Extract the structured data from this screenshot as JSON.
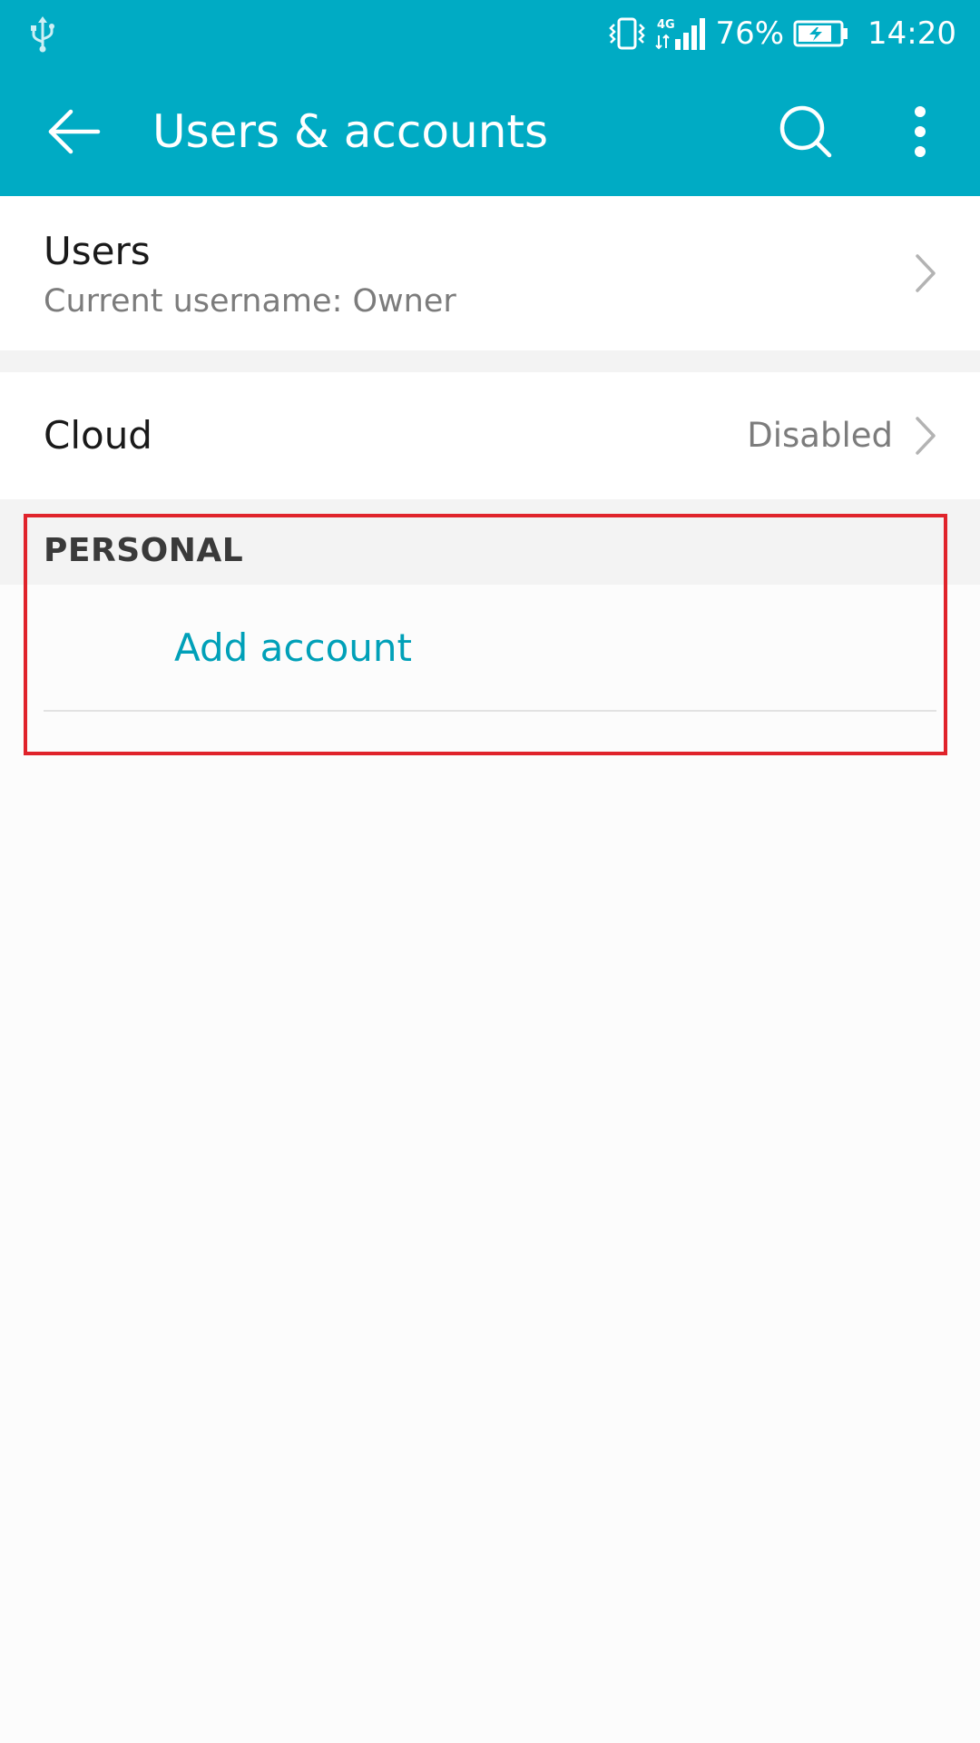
{
  "status_bar": {
    "network": "4G",
    "battery_percent": "76%",
    "time": "14:20",
    "icons": [
      "usb-icon",
      "vibrate-icon",
      "signal-icon",
      "battery-charging-icon"
    ]
  },
  "toolbar": {
    "title": "Users & accounts",
    "icons": [
      "back-arrow-icon",
      "search-icon",
      "more-vert-icon"
    ]
  },
  "settings": {
    "users": {
      "title": "Users",
      "subtitle": "Current username: Owner"
    },
    "cloud": {
      "title": "Cloud",
      "value": "Disabled"
    }
  },
  "personal": {
    "header": "PERSONAL",
    "add_account": "Add account"
  },
  "colors": {
    "accent": "#00abc4",
    "link": "#00a0b8",
    "highlight": "#e0232b"
  }
}
